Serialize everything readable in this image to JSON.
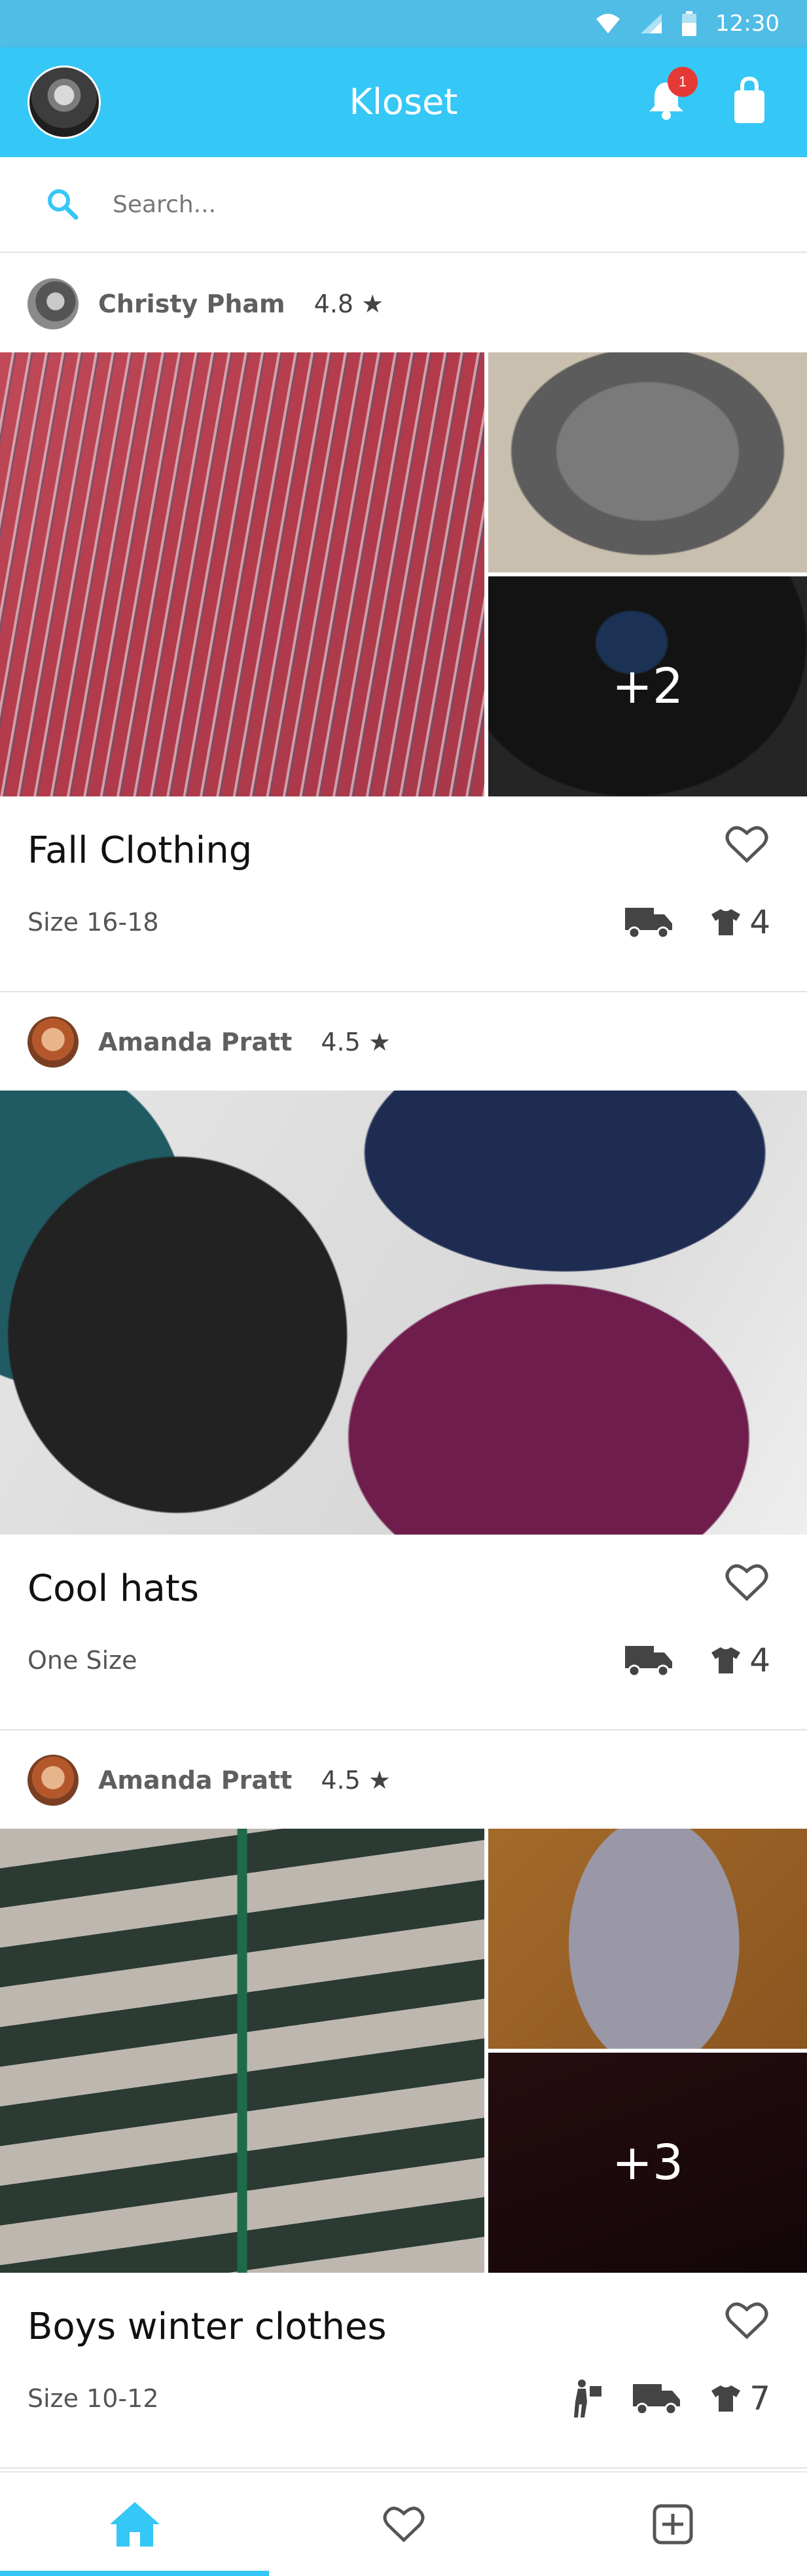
{
  "status_bar": {
    "time": "12:30",
    "icons": [
      "wifi-icon",
      "signal-icon",
      "battery-icon"
    ]
  },
  "app_bar": {
    "title": "Kloset",
    "notification_count": "1"
  },
  "search": {
    "placeholder": "Search..."
  },
  "colors": {
    "primary": "#35c7f5",
    "status_bar": "#4fbde6",
    "badge": "#e53935"
  },
  "listings": [
    {
      "seller": "Christy Pham",
      "rating": "4.8 ★",
      "title": "Fall Clothing",
      "size": "Size 16-18",
      "item_count": "4",
      "extra_photos": "+2",
      "delivery_options": [
        "shipping-truck-icon"
      ]
    },
    {
      "seller": "Amanda Pratt",
      "rating": "4.5 ★",
      "title": "Cool hats",
      "size": "One Size",
      "item_count": "4",
      "delivery_options": [
        "shipping-truck-icon"
      ]
    },
    {
      "seller": "Amanda Pratt",
      "rating": "4.5 ★",
      "title": "Boys winter clothes",
      "size": "Size 10-12",
      "item_count": "7",
      "extra_photos": "+3",
      "delivery_options": [
        "pickup-person-icon",
        "shipping-truck-icon"
      ]
    }
  ],
  "bottom_nav": {
    "tabs": [
      "home-icon",
      "favorites-icon",
      "add-listing-icon"
    ],
    "active": "home-icon"
  }
}
